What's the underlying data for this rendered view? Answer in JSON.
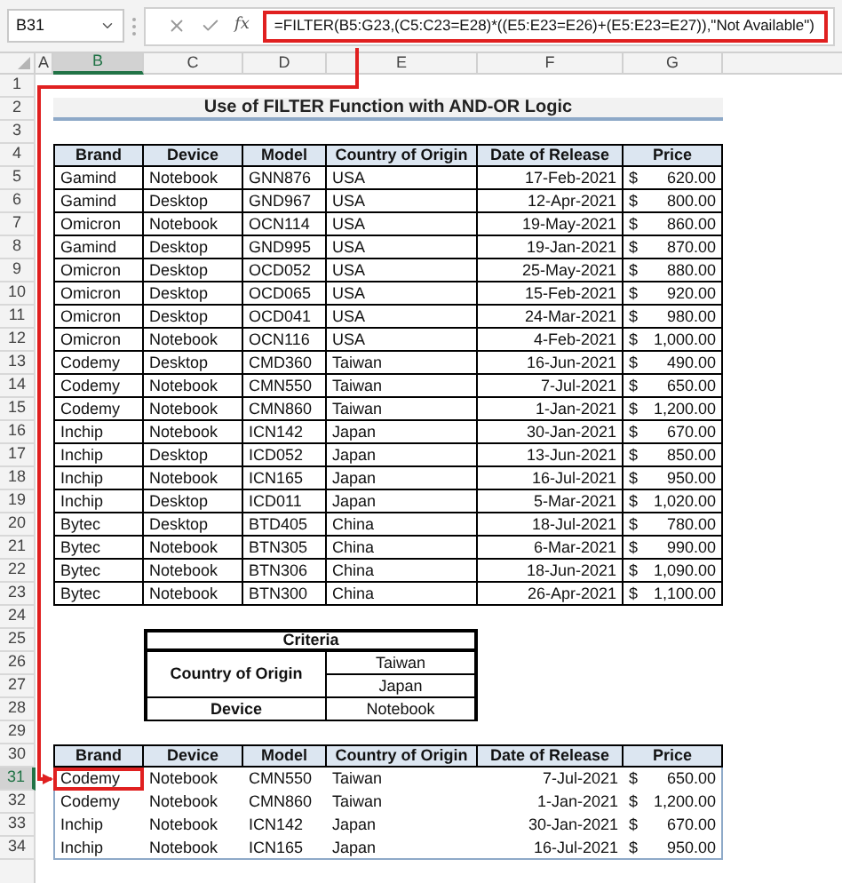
{
  "formula_bar": {
    "name_box": "B31",
    "fx": "fx",
    "formula": "=FILTER(B5:G23,(C5:C23=E28)*((E5:E23=E26)+(E5:E23=E27)),\"Not Available\")"
  },
  "columns": [
    {
      "label": "A",
      "selected": false
    },
    {
      "label": "B",
      "selected": true
    },
    {
      "label": "C",
      "selected": false
    },
    {
      "label": "D",
      "selected": false
    },
    {
      "label": "E",
      "selected": false
    },
    {
      "label": "F",
      "selected": false
    },
    {
      "label": "G",
      "selected": false
    }
  ],
  "rows": [
    {
      "label": "1",
      "selected": false
    },
    {
      "label": "2",
      "selected": false
    },
    {
      "label": "3",
      "selected": false
    },
    {
      "label": "4",
      "selected": false
    },
    {
      "label": "5",
      "selected": false
    },
    {
      "label": "6",
      "selected": false
    },
    {
      "label": "7",
      "selected": false
    },
    {
      "label": "8",
      "selected": false
    },
    {
      "label": "9",
      "selected": false
    },
    {
      "label": "10",
      "selected": false
    },
    {
      "label": "11",
      "selected": false
    },
    {
      "label": "12",
      "selected": false
    },
    {
      "label": "13",
      "selected": false
    },
    {
      "label": "14",
      "selected": false
    },
    {
      "label": "15",
      "selected": false
    },
    {
      "label": "16",
      "selected": false
    },
    {
      "label": "17",
      "selected": false
    },
    {
      "label": "18",
      "selected": false
    },
    {
      "label": "19",
      "selected": false
    },
    {
      "label": "20",
      "selected": false
    },
    {
      "label": "21",
      "selected": false
    },
    {
      "label": "22",
      "selected": false
    },
    {
      "label": "23",
      "selected": false
    },
    {
      "label": "24",
      "selected": false
    },
    {
      "label": "25",
      "selected": false
    },
    {
      "label": "26",
      "selected": false
    },
    {
      "label": "27",
      "selected": false
    },
    {
      "label": "28",
      "selected": false
    },
    {
      "label": "29",
      "selected": false
    },
    {
      "label": "30",
      "selected": false
    },
    {
      "label": "31",
      "selected": true
    },
    {
      "label": "32",
      "selected": false
    },
    {
      "label": "33",
      "selected": false
    },
    {
      "label": "34",
      "selected": false
    }
  ],
  "title": "Use of FILTER Function with AND-OR Logic",
  "main_table": {
    "columns": [
      "Brand",
      "Device",
      "Model",
      "Country of Origin",
      "Date of Release",
      "Price"
    ],
    "rows": [
      {
        "brand": "Gamind",
        "device": "Notebook",
        "model": "GNN876",
        "country": "USA",
        "date": "17-Feb-2021",
        "currency": "$",
        "price": "620.00"
      },
      {
        "brand": "Gamind",
        "device": "Desktop",
        "model": "GND967",
        "country": "USA",
        "date": "12-Apr-2021",
        "currency": "$",
        "price": "800.00"
      },
      {
        "brand": "Omicron",
        "device": "Notebook",
        "model": "OCN114",
        "country": "USA",
        "date": "19-May-2021",
        "currency": "$",
        "price": "860.00"
      },
      {
        "brand": "Gamind",
        "device": "Desktop",
        "model": "GND995",
        "country": "USA",
        "date": "19-Jan-2021",
        "currency": "$",
        "price": "870.00"
      },
      {
        "brand": "Omicron",
        "device": "Desktop",
        "model": "OCD052",
        "country": "USA",
        "date": "25-May-2021",
        "currency": "$",
        "price": "880.00"
      },
      {
        "brand": "Omicron",
        "device": "Desktop",
        "model": "OCD065",
        "country": "USA",
        "date": "15-Feb-2021",
        "currency": "$",
        "price": "920.00"
      },
      {
        "brand": "Omicron",
        "device": "Desktop",
        "model": "OCD041",
        "country": "USA",
        "date": "24-Mar-2021",
        "currency": "$",
        "price": "980.00"
      },
      {
        "brand": "Omicron",
        "device": "Notebook",
        "model": "OCN116",
        "country": "USA",
        "date": "4-Feb-2021",
        "currency": "$",
        "price": "1,000.00"
      },
      {
        "brand": "Codemy",
        "device": "Desktop",
        "model": "CMD360",
        "country": "Taiwan",
        "date": "16-Jun-2021",
        "currency": "$",
        "price": "490.00"
      },
      {
        "brand": "Codemy",
        "device": "Notebook",
        "model": "CMN550",
        "country": "Taiwan",
        "date": "7-Jul-2021",
        "currency": "$",
        "price": "650.00"
      },
      {
        "brand": "Codemy",
        "device": "Notebook",
        "model": "CMN860",
        "country": "Taiwan",
        "date": "1-Jan-2021",
        "currency": "$",
        "price": "1,200.00"
      },
      {
        "brand": "Inchip",
        "device": "Notebook",
        "model": "ICN142",
        "country": "Japan",
        "date": "30-Jan-2021",
        "currency": "$",
        "price": "670.00"
      },
      {
        "brand": "Inchip",
        "device": "Desktop",
        "model": "ICD052",
        "country": "Japan",
        "date": "13-Jun-2021",
        "currency": "$",
        "price": "850.00"
      },
      {
        "brand": "Inchip",
        "device": "Notebook",
        "model": "ICN165",
        "country": "Japan",
        "date": "16-Jul-2021",
        "currency": "$",
        "price": "950.00"
      },
      {
        "brand": "Inchip",
        "device": "Desktop",
        "model": "ICD011",
        "country": "Japan",
        "date": "5-Mar-2021",
        "currency": "$",
        "price": "1,020.00"
      },
      {
        "brand": "Bytec",
        "device": "Desktop",
        "model": "BTD405",
        "country": "China",
        "date": "18-Jul-2021",
        "currency": "$",
        "price": "780.00"
      },
      {
        "brand": "Bytec",
        "device": "Notebook",
        "model": "BTN305",
        "country": "China",
        "date": "6-Mar-2021",
        "currency": "$",
        "price": "990.00"
      },
      {
        "brand": "Bytec",
        "device": "Notebook",
        "model": "BTN306",
        "country": "China",
        "date": "18-Jun-2021",
        "currency": "$",
        "price": "1,090.00"
      },
      {
        "brand": "Bytec",
        "device": "Notebook",
        "model": "BTN300",
        "country": "China",
        "date": "26-Apr-2021",
        "currency": "$",
        "price": "1,100.00"
      }
    ]
  },
  "criteria": {
    "title": "Criteria",
    "rows": [
      {
        "label": "Country of Origin",
        "values": [
          "Taiwan",
          "Japan"
        ]
      },
      {
        "label": "Device",
        "values": [
          "Notebook"
        ]
      }
    ]
  },
  "result_table": {
    "columns": [
      "Brand",
      "Device",
      "Model",
      "Country of Origin",
      "Date of Release",
      "Price"
    ],
    "rows": [
      {
        "brand": "Codemy",
        "device": "Notebook",
        "model": "CMN550",
        "country": "Taiwan",
        "date": "7-Jul-2021",
        "currency": "$",
        "price": "650.00"
      },
      {
        "brand": "Codemy",
        "device": "Notebook",
        "model": "CMN860",
        "country": "Taiwan",
        "date": "1-Jan-2021",
        "currency": "$",
        "price": "1,200.00"
      },
      {
        "brand": "Inchip",
        "device": "Notebook",
        "model": "ICN142",
        "country": "Japan",
        "date": "30-Jan-2021",
        "currency": "$",
        "price": "670.00"
      },
      {
        "brand": "Inchip",
        "device": "Notebook",
        "model": "ICN165",
        "country": "Japan",
        "date": "16-Jul-2021",
        "currency": "$",
        "price": "950.00"
      }
    ]
  }
}
